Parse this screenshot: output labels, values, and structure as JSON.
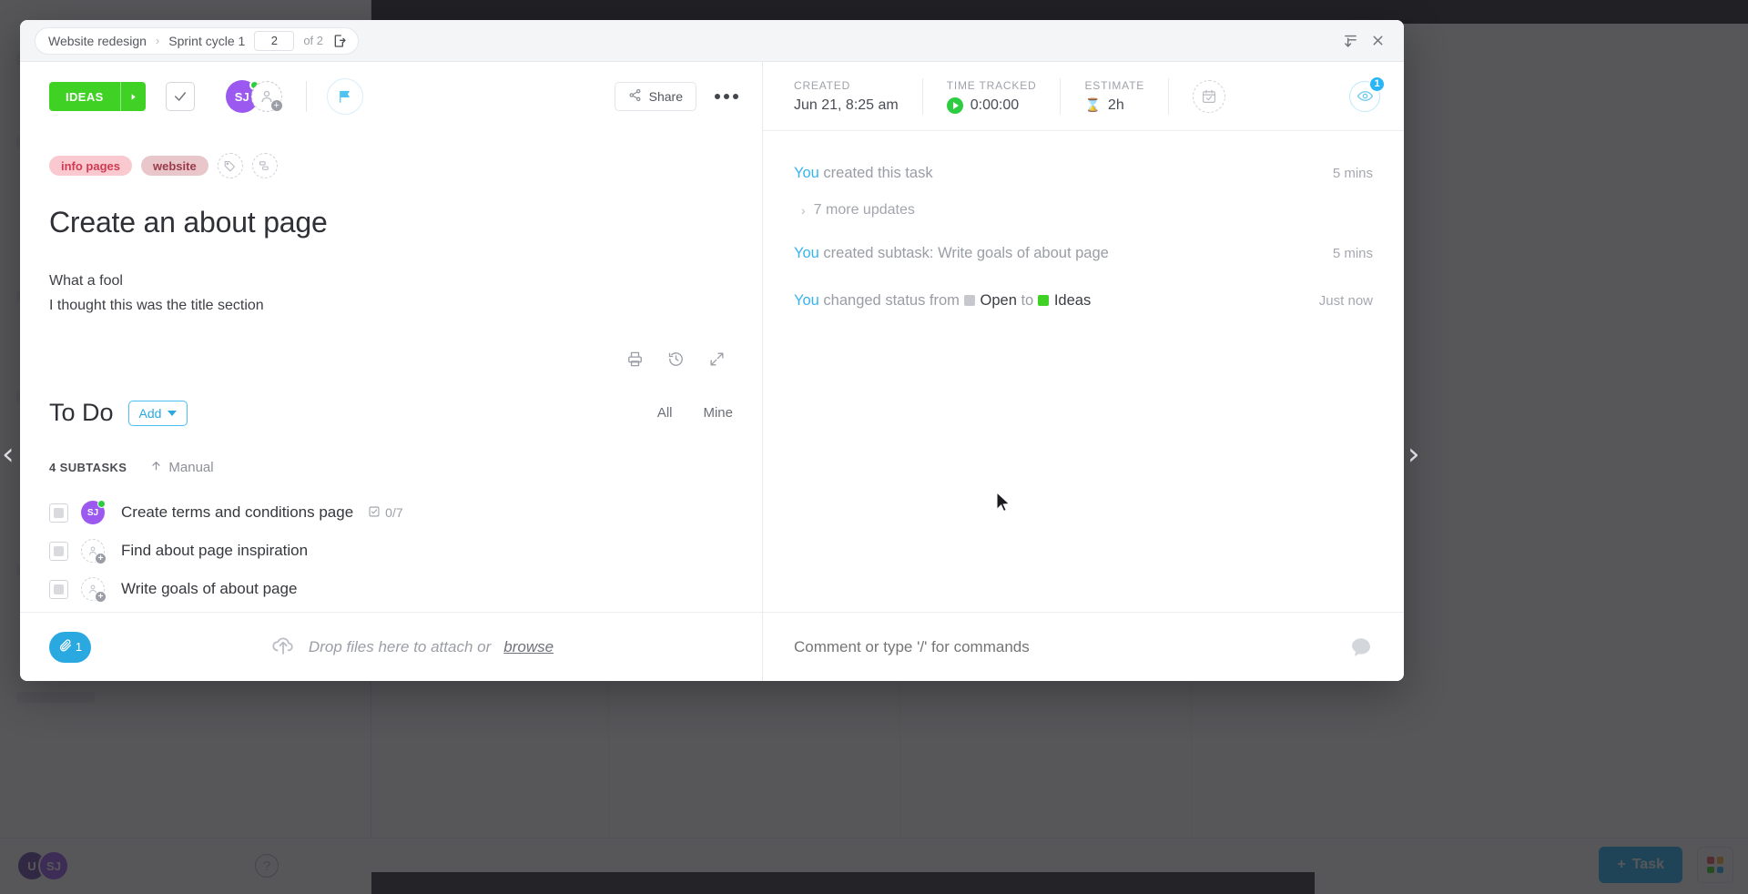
{
  "background": {
    "board_card_label": "Write goals of about page",
    "avatars": [
      {
        "initials": "U",
        "color": "#6b4fa8"
      },
      {
        "initials": "SJ",
        "color": "#9b59f0"
      }
    ],
    "help_icon": "help-icon",
    "task_button_label": "Task",
    "grid_button": "apps-grid-icon"
  },
  "modal": {
    "breadcrumb": {
      "space": "Website redesign",
      "separator": "›",
      "list": "Sprint cycle 1",
      "page_current": "2",
      "page_of": "of 2",
      "open_in_new_icon": "open-in-new-icon"
    },
    "window_controls": {
      "collapse_icon": "collapse-icon",
      "close_icon": "close-icon"
    },
    "left": {
      "status": {
        "label": "IDEAS",
        "color": "#3fd124",
        "caret_icon": "caret-right-icon"
      },
      "resolve_icon": "check-icon",
      "assignee": {
        "initials": "SJ",
        "color": "#9b59f0",
        "online": true
      },
      "add_assignee_icon": "add-person-icon",
      "flag_icon": "flag-icon",
      "flag_color": "#4ec3f0",
      "share_label": "Share",
      "share_icon": "share-icon",
      "more_icon": "more-horizontal-icon",
      "tags": [
        {
          "label": "info pages",
          "bg": "#f9c9cf",
          "fg": "#cf3b52"
        },
        {
          "label": "website",
          "bg": "#e8c6ca",
          "fg": "#9a3b4a"
        }
      ],
      "add_tag_icon": "tag-icon",
      "add_field_icon": "custom-field-icon",
      "title": "Create an about page",
      "description_lines": [
        "What a fool",
        "I thought this was the title section"
      ],
      "description_tools": [
        "print-icon",
        "history-icon",
        "expand-icon"
      ],
      "todo": {
        "heading": "To Do",
        "add_label": "Add",
        "filters": [
          "All",
          "Mine"
        ],
        "subtasks_count_label": "4 SUBTASKS",
        "sort_label": "Manual",
        "sort_icon": "arrow-up-icon"
      },
      "subtasks": [
        {
          "label": "Create terms and conditions page",
          "avatar": "SJ",
          "avatar_type": "filled",
          "online": true,
          "checklist": "0/7",
          "checklist_icon": "checklist-icon"
        },
        {
          "label": "Find about page inspiration",
          "avatar": "",
          "avatar_type": "empty",
          "online": false,
          "checklist": "",
          "checklist_icon": ""
        },
        {
          "label": "Write goals of about page",
          "avatar": "",
          "avatar_type": "empty",
          "online": false,
          "checklist": "",
          "checklist_icon": ""
        }
      ],
      "attachment": {
        "count": "1",
        "icon": "paperclip-icon",
        "drop_text": "Drop files here to attach or",
        "browse_label": "browse",
        "cloud_icon": "cloud-upload-icon"
      }
    },
    "right": {
      "meta": [
        {
          "label": "CREATED",
          "value": "Jun 21, 8:25 am",
          "icon": ""
        },
        {
          "label": "TIME TRACKED",
          "value": "0:00:00",
          "icon": "play-icon"
        },
        {
          "label": "ESTIMATE",
          "value": "2h",
          "icon": "hourglass-icon"
        }
      ],
      "date_icon": "calendar-check-icon",
      "watch": {
        "icon": "eye-icon",
        "badge": "1"
      },
      "activity": [
        {
          "actor": "You",
          "text": " created this task",
          "time": "5 mins",
          "type": "plain"
        },
        {
          "actor": "You",
          "text": " created subtask: Write goals of about page",
          "time": "5 mins",
          "type": "plain"
        },
        {
          "actor": "You",
          "prefix": " changed status from ",
          "from_status": "Open",
          "from_color": "#c6c8cd",
          "mid": " to ",
          "to_status": "Ideas",
          "to_color": "#3fd124",
          "time": "Just now",
          "type": "status"
        }
      ],
      "more_updates_label": "7 more updates",
      "more_updates_caret": "chevron-right-icon",
      "comment_placeholder": "Comment or type '/' for commands",
      "comment_icon": "comment-bubble-icon"
    }
  },
  "nav": {
    "prev_icon": "‹",
    "next_icon": "›"
  }
}
